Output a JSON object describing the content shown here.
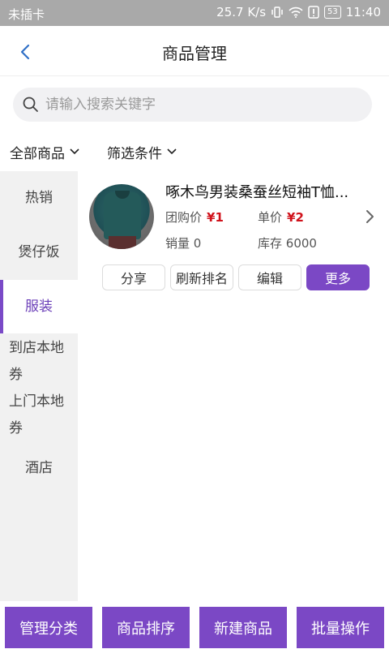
{
  "status_bar": {
    "carrier": "未插卡",
    "speed": "25.7 K/s",
    "battery": "53",
    "time": "11:40"
  },
  "header": {
    "title": "商品管理"
  },
  "search": {
    "placeholder": "请输入搜索关键字"
  },
  "filters": {
    "all_products": "全部商品",
    "filter_conditions": "筛选条件"
  },
  "categories": [
    {
      "label": "热销"
    },
    {
      "label": "煲仔饭"
    },
    {
      "label": "服装",
      "active": true
    },
    {
      "label_line1": "到店本地",
      "label_line2": "券"
    },
    {
      "label_line1": "上门本地",
      "label_line2": "券"
    },
    {
      "label": "酒店"
    }
  ],
  "product": {
    "name": "啄木鸟男装桑蚕丝短袖T恤...",
    "group_price_label": "团购价",
    "group_price": "¥1",
    "unit_price_label": "单价",
    "unit_price": "¥2",
    "sales_label": "销量",
    "sales": "0",
    "stock_label": "库存",
    "stock": "6000",
    "actions": {
      "share": "分享",
      "refresh_rank": "刷新排名",
      "edit": "编辑",
      "more": "更多"
    }
  },
  "bottom_bar": {
    "manage_category": "管理分类",
    "sort_products": "商品排序",
    "new_product": "新建商品",
    "batch_operation": "批量操作"
  },
  "colors": {
    "accent": "#7b48c5",
    "price": "#d0121b",
    "status_bar": "#a9a9a9",
    "sidebar_bg": "#f1f1f1"
  }
}
